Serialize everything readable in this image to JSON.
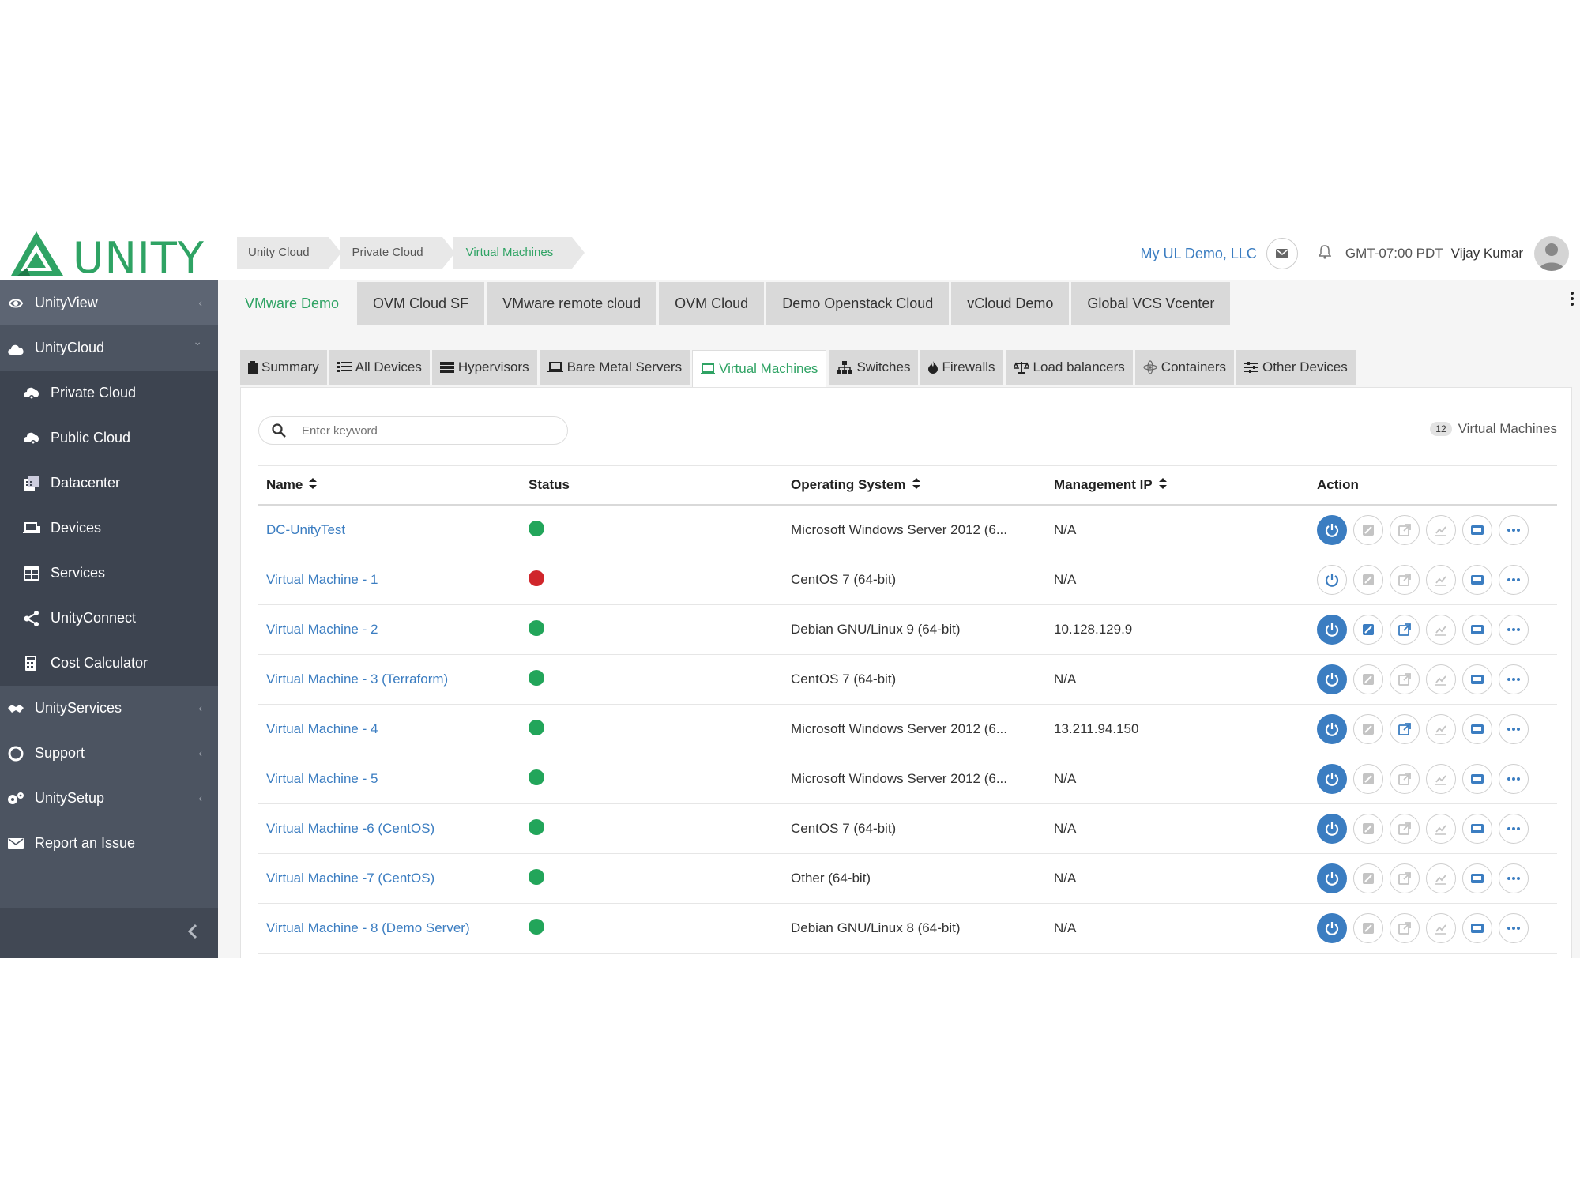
{
  "brand": {
    "name": "UNITY",
    "color": "#2fa364"
  },
  "breadcrumbs": [
    "Unity Cloud",
    "Private Cloud",
    "Virtual Machines"
  ],
  "header": {
    "org": "My UL Demo, LLC",
    "timezone": "GMT-07:00 PDT",
    "user": "Vijay Kumar"
  },
  "sidebar": {
    "items": [
      {
        "label": "UnityView",
        "icon": "eye-cycle-icon",
        "chevron": "‹"
      },
      {
        "label": "UnityCloud",
        "icon": "cloud-icon",
        "chevron": "⌄"
      }
    ],
    "sub_items": [
      {
        "label": "Private Cloud",
        "icon": "cloud-gear-icon"
      },
      {
        "label": "Public Cloud",
        "icon": "cloud-gear-icon"
      },
      {
        "label": "Datacenter",
        "icon": "building-icon"
      },
      {
        "label": "Devices",
        "icon": "laptop-icon"
      },
      {
        "label": "Services",
        "icon": "grid-icon"
      },
      {
        "label": "UnityConnect",
        "icon": "share-nodes-icon"
      },
      {
        "label": "Cost Calculator",
        "icon": "calculator-icon"
      }
    ],
    "bottom_items": [
      {
        "label": "UnityServices",
        "icon": "handshake-icon",
        "chevron": "‹"
      },
      {
        "label": "Support",
        "icon": "lifebuoy-icon",
        "chevron": "‹"
      },
      {
        "label": "UnitySetup",
        "icon": "gears-icon",
        "chevron": "‹"
      },
      {
        "label": "Report an Issue",
        "icon": "envelope-icon"
      }
    ]
  },
  "cloud_tabs": [
    "VMware Demo",
    "OVM Cloud SF",
    "VMware remote cloud",
    "OVM Cloud",
    "Demo Openstack Cloud",
    "vCloud Demo",
    "Global VCS Vcenter"
  ],
  "active_cloud_tab": 0,
  "sub_tabs": [
    {
      "label": "Summary",
      "icon": "clipboard-icon"
    },
    {
      "label": "All Devices",
      "icon": "list-icon"
    },
    {
      "label": "Hypervisors",
      "icon": "server-icon"
    },
    {
      "label": "Bare Metal Servers",
      "icon": "laptop-icon"
    },
    {
      "label": "Virtual Machines",
      "icon": "vm-icon"
    },
    {
      "label": "Switches",
      "icon": "sitemap-icon"
    },
    {
      "label": "Firewalls",
      "icon": "fire-icon"
    },
    {
      "label": "Load balancers",
      "icon": "balance-scale-icon"
    },
    {
      "label": "Containers",
      "icon": "atom-icon"
    },
    {
      "label": "Other Devices",
      "icon": "sliders-icon"
    }
  ],
  "active_sub_tab": 4,
  "search": {
    "placeholder": "Enter keyword"
  },
  "vm_count": {
    "value": "12",
    "label": "Virtual Machines"
  },
  "table": {
    "columns": [
      "Name",
      "Status",
      "Operating System",
      "Management IP",
      "Action"
    ],
    "rows": [
      {
        "name": "DC-UnityTest",
        "status": "up",
        "os": "Microsoft Windows Server 2012 (6...",
        "ip": "N/A",
        "power": true,
        "console": false,
        "launch": false
      },
      {
        "name": "Virtual Machine - 1",
        "status": "down",
        "os": "CentOS 7 (64-bit)",
        "ip": "N/A",
        "power": false,
        "console": false,
        "launch": false
      },
      {
        "name": "Virtual Machine - 2",
        "status": "up",
        "os": "Debian GNU/Linux 9 (64-bit)",
        "ip": "10.128.129.9",
        "power": true,
        "console": true,
        "launch": true
      },
      {
        "name": "Virtual Machine - 3 (Terraform)",
        "status": "up",
        "os": "CentOS 7 (64-bit)",
        "ip": "N/A",
        "power": true,
        "console": false,
        "launch": false
      },
      {
        "name": "Virtual Machine - 4",
        "status": "up",
        "os": "Microsoft Windows Server 2012 (6...",
        "ip": "13.211.94.150",
        "power": true,
        "console": false,
        "launch": true
      },
      {
        "name": "Virtual Machine - 5",
        "status": "up",
        "os": "Microsoft Windows Server 2012 (6...",
        "ip": "N/A",
        "power": true,
        "console": false,
        "launch": false
      },
      {
        "name": "Virtual Machine -6 (CentOS)",
        "status": "up",
        "os": "CentOS 7 (64-bit)",
        "ip": "N/A",
        "power": true,
        "console": false,
        "launch": false
      },
      {
        "name": "Virtual Machine -7 (CentOS)",
        "status": "up",
        "os": "Other (64-bit)",
        "ip": "N/A",
        "power": true,
        "console": false,
        "launch": false
      },
      {
        "name": "Virtual Machine - 8 (Demo Server)",
        "status": "up",
        "os": "Debian GNU/Linux 8 (64-bit)",
        "ip": "N/A",
        "power": true,
        "console": false,
        "launch": false
      }
    ]
  },
  "colors": {
    "accent_green": "#2fa364",
    "link_blue": "#3b7dc1",
    "status_up": "#22a55a",
    "status_down": "#d0262b",
    "sidebar_bg": "#4c5461"
  }
}
